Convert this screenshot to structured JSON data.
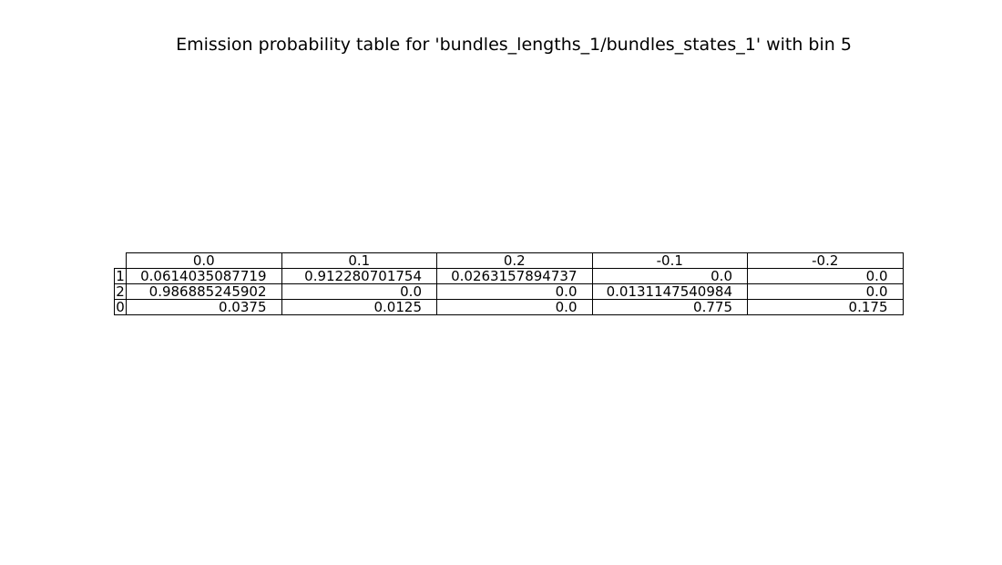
{
  "chart_data": {
    "type": "table",
    "title": "Emission probability table for 'bundles_lengths_1/bundles_states_1' with bin 5",
    "columns": [
      "0.0",
      "0.1",
      "0.2",
      "-0.1",
      "-0.2"
    ],
    "rows": [
      {
        "label": "1",
        "values": [
          "0.0614035087719",
          "0.912280701754",
          "0.0263157894737",
          "0.0",
          "0.0"
        ]
      },
      {
        "label": "2",
        "values": [
          "0.986885245902",
          "0.0",
          "0.0",
          "0.0131147540984",
          "0.0"
        ]
      },
      {
        "label": "0",
        "values": [
          "0.0375",
          "0.0125",
          "0.0",
          "0.775",
          "0.175"
        ]
      }
    ]
  }
}
